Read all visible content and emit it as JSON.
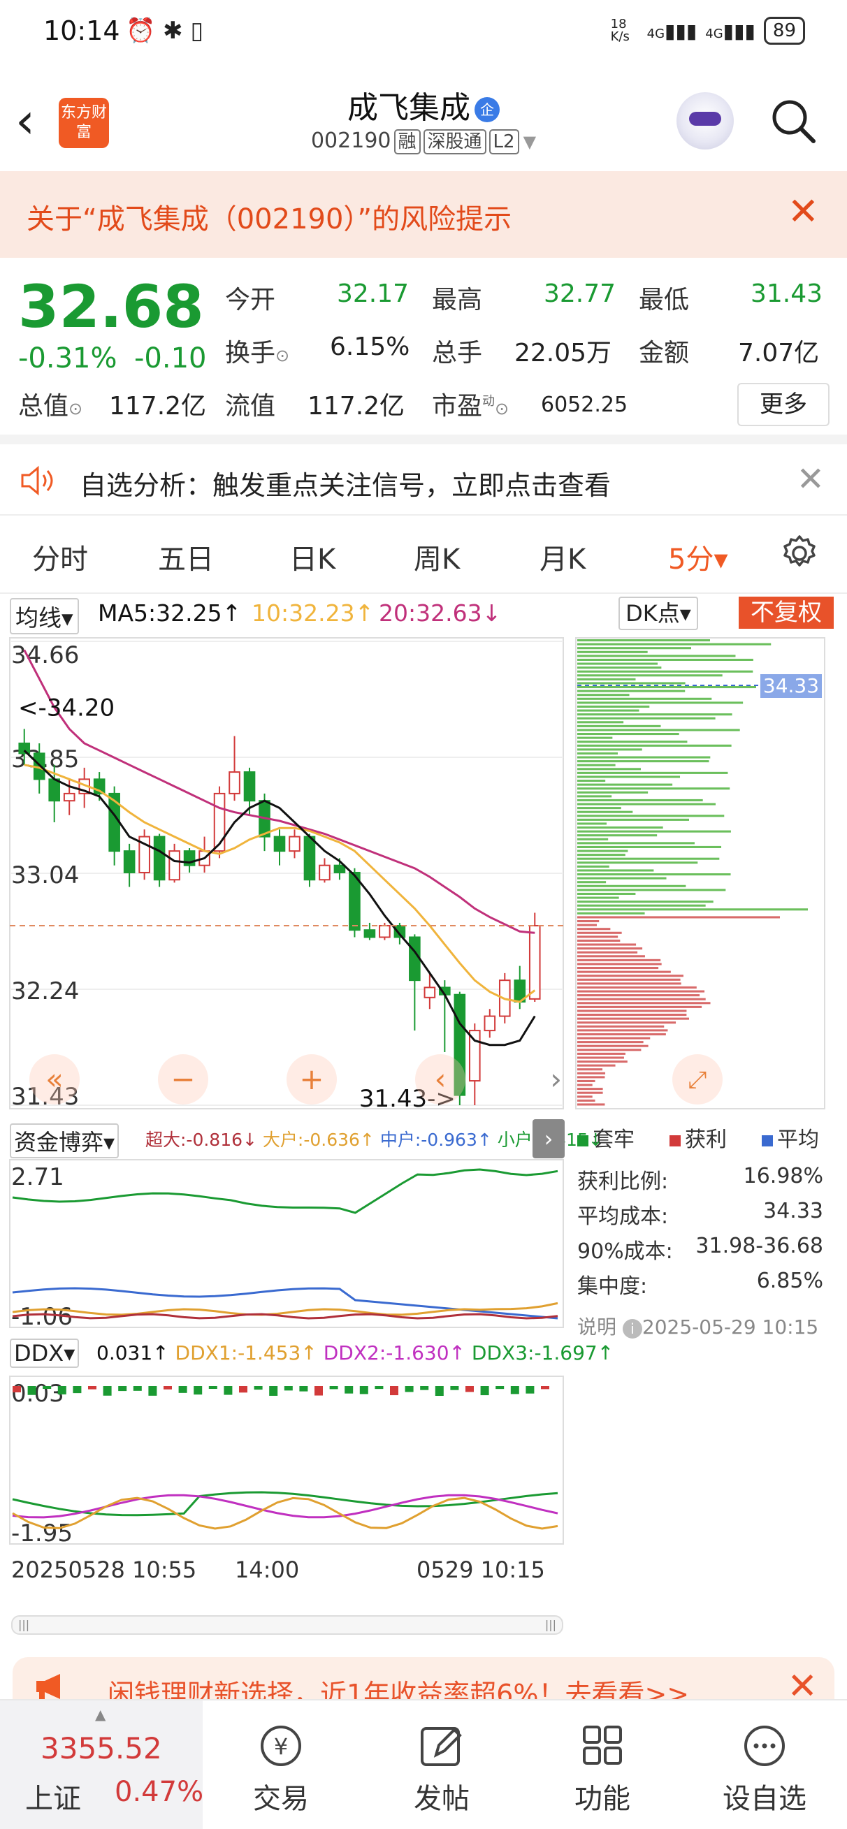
{
  "status_bar": {
    "time": "10:14",
    "net_speed": "18 K/s",
    "signal1": "4G",
    "signal2": "4G",
    "battery": "89"
  },
  "header": {
    "back": "‹",
    "logo": "东方财富",
    "title": "成飞集成",
    "qi_badge": "企",
    "code": "002190",
    "tags": [
      "融",
      "深股通",
      "L2"
    ]
  },
  "risk_banner": {
    "text": "关于“成飞集成（002190）”的风险提示",
    "close": "✕"
  },
  "quote": {
    "price": "32.68",
    "change_pct": "-0.31%",
    "change_amt": "-0.10",
    "open_label": "今开",
    "open": "32.17",
    "high_label": "最高",
    "high": "32.77",
    "low_label": "最低",
    "low": "31.43",
    "turnover_label": "换手",
    "turnover": "6.15%",
    "volume_label": "总手",
    "volume": "22.05万",
    "amount_label": "金额",
    "amount": "7.07亿",
    "mktcap_label": "总值",
    "mktcap": "117.2亿",
    "float_label": "流值",
    "float": "117.2亿",
    "pe_label": "市盈",
    "pe_sup": "动",
    "pe": "6052.25",
    "more": "更多"
  },
  "notice": {
    "text": "自选分析：触发重点关注信号，立即点击查看",
    "close": "✕"
  },
  "tabs": [
    "分时",
    "五日",
    "日K",
    "周K",
    "月K",
    "5分▾"
  ],
  "chart_header": {
    "ma_select": "均线▾",
    "ma5": "MA5:32.25↑",
    "ma10": "10:32.23↑",
    "ma20": "20:32.63↓",
    "dk": "DK点▾",
    "fq": "不复权"
  },
  "colors": {
    "up": "#d23a3a",
    "down": "#1a9a32",
    "ma5": "#111111",
    "ma10": "#f0b43c",
    "ma20": "#c0307a",
    "accent": "#f05a24"
  },
  "chart_data": {
    "type": "candlestick",
    "yticks": [
      "34.66",
      "33.85",
      "33.04",
      "32.24",
      "31.43"
    ],
    "ylim": [
      31.43,
      34.66
    ],
    "annotations": [
      "<-34.20",
      "31.43->"
    ],
    "candles": [
      [
        33.95,
        33.88,
        34.05,
        33.8
      ],
      [
        33.88,
        33.7,
        33.95,
        33.6
      ],
      [
        33.7,
        33.55,
        33.8,
        33.4
      ],
      [
        33.55,
        33.6,
        33.7,
        33.45
      ],
      [
        33.6,
        33.7,
        33.78,
        33.5
      ],
      [
        33.7,
        33.6,
        33.75,
        33.55
      ],
      [
        33.6,
        33.2,
        33.65,
        33.1
      ],
      [
        33.2,
        33.05,
        33.25,
        32.95
      ],
      [
        33.05,
        33.3,
        33.35,
        33.0
      ],
      [
        33.3,
        33.0,
        33.32,
        32.95
      ],
      [
        33.0,
        33.2,
        33.25,
        32.98
      ],
      [
        33.2,
        33.1,
        33.22,
        33.05
      ],
      [
        33.1,
        33.2,
        33.3,
        33.05
      ],
      [
        33.2,
        33.6,
        33.65,
        33.15
      ],
      [
        33.6,
        33.75,
        34.0,
        33.55
      ],
      [
        33.75,
        33.55,
        33.78,
        33.45
      ],
      [
        33.55,
        33.3,
        33.6,
        33.2
      ],
      [
        33.3,
        33.2,
        33.35,
        33.1
      ],
      [
        33.2,
        33.3,
        33.35,
        33.15
      ],
      [
        33.3,
        33.0,
        33.32,
        32.95
      ],
      [
        33.0,
        33.1,
        33.15,
        32.98
      ],
      [
        33.1,
        33.05,
        33.15,
        33.0
      ],
      [
        33.05,
        32.65,
        33.08,
        32.6
      ],
      [
        32.65,
        32.6,
        32.7,
        32.58
      ],
      [
        32.6,
        32.68,
        32.7,
        32.58
      ],
      [
        32.68,
        32.6,
        32.7,
        32.55
      ],
      [
        32.6,
        32.3,
        32.62,
        31.95
      ],
      [
        32.18,
        32.25,
        32.35,
        32.1
      ],
      [
        32.25,
        32.2,
        32.3,
        31.8
      ],
      [
        32.2,
        31.5,
        32.22,
        31.43
      ],
      [
        31.6,
        31.95,
        32.0,
        31.43
      ],
      [
        31.95,
        32.05,
        32.1,
        31.9
      ],
      [
        32.05,
        32.3,
        32.35,
        32.0
      ],
      [
        32.3,
        32.15,
        32.4,
        32.1
      ],
      [
        32.17,
        32.68,
        32.77,
        32.15
      ]
    ],
    "ma5": [
      33.9,
      33.8,
      33.7,
      33.65,
      33.62,
      33.58,
      33.45,
      33.3,
      33.25,
      33.2,
      33.13,
      33.12,
      33.15,
      33.25,
      33.4,
      33.5,
      33.55,
      33.5,
      33.4,
      33.3,
      33.2,
      33.13,
      33.03,
      32.9,
      32.75,
      32.62,
      32.5,
      32.35,
      32.2,
      32.0,
      31.88,
      31.85,
      31.85,
      31.88,
      32.05
    ],
    "ma10": [
      33.8,
      33.78,
      33.74,
      33.7,
      33.66,
      33.62,
      33.55,
      33.47,
      33.4,
      33.35,
      33.3,
      33.25,
      33.2,
      33.18,
      33.22,
      33.28,
      33.32,
      33.36,
      33.36,
      33.34,
      33.3,
      33.26,
      33.2,
      33.1,
      33.0,
      32.9,
      32.8,
      32.68,
      32.55,
      32.42,
      32.3,
      32.22,
      32.17,
      32.15,
      32.23
    ],
    "ma20": [
      34.6,
      34.4,
      34.2,
      34.05,
      33.95,
      33.9,
      33.85,
      33.8,
      33.75,
      33.7,
      33.65,
      33.6,
      33.55,
      33.5,
      33.47,
      33.45,
      33.43,
      33.41,
      33.38,
      33.35,
      33.32,
      33.28,
      33.24,
      33.2,
      33.16,
      33.12,
      33.08,
      33.02,
      32.95,
      32.88,
      32.8,
      32.74,
      32.69,
      32.64,
      32.63
    ]
  },
  "profile": {
    "price_tag": "34.33",
    "legend": [
      "套牢",
      "获利",
      "平均"
    ],
    "rows": [
      {
        "k": "获利比例:",
        "v": "16.98%"
      },
      {
        "k": "平均成本:",
        "v": "34.33"
      },
      {
        "k": "90%成本:",
        "v": "31.98-36.68"
      },
      {
        "k": "集中度:",
        "v": "6.85%"
      }
    ],
    "note_label": "说明",
    "timestamp": "2025-05-29 10:15"
  },
  "funds": {
    "select": "资金博弈▾",
    "items": [
      {
        "label": "超大:-0.816↓",
        "color": "#b0303a"
      },
      {
        "label": "大户:-0.636↑",
        "color": "#f0b43c"
      },
      {
        "label": "中户:-0.963↑",
        "color": "#3a6ad0"
      },
      {
        "label": "小户:2.415↓",
        "color": "#1a9a32"
      }
    ],
    "yticks": [
      "2.71",
      "-1.06"
    ]
  },
  "ddx": {
    "select": "DDX▾",
    "items": [
      {
        "label": "0.031↑",
        "color": "#111111"
      },
      {
        "label": "DDX1:-1.453↑",
        "color": "#f0b43c"
      },
      {
        "label": "DDX2:-1.630↑",
        "color": "#c030c0"
      },
      {
        "label": "DDX3:-1.697↑",
        "color": "#1a9a32"
      }
    ],
    "yticks": [
      "0.03",
      "-1.95"
    ]
  },
  "xaxis": {
    "start": "20250528 10:55",
    "mid": "14:00",
    "end": "0529 10:15"
  },
  "bottom_banner": {
    "text": "闲钱理财新选择，近1年收益率超6%！去看看>>",
    "close": "✕"
  },
  "nav": {
    "index_value": "3355.52",
    "index_name": "上证",
    "index_pct": "0.47%",
    "items": [
      "交易",
      "发帖",
      "功能",
      "设自选"
    ]
  }
}
